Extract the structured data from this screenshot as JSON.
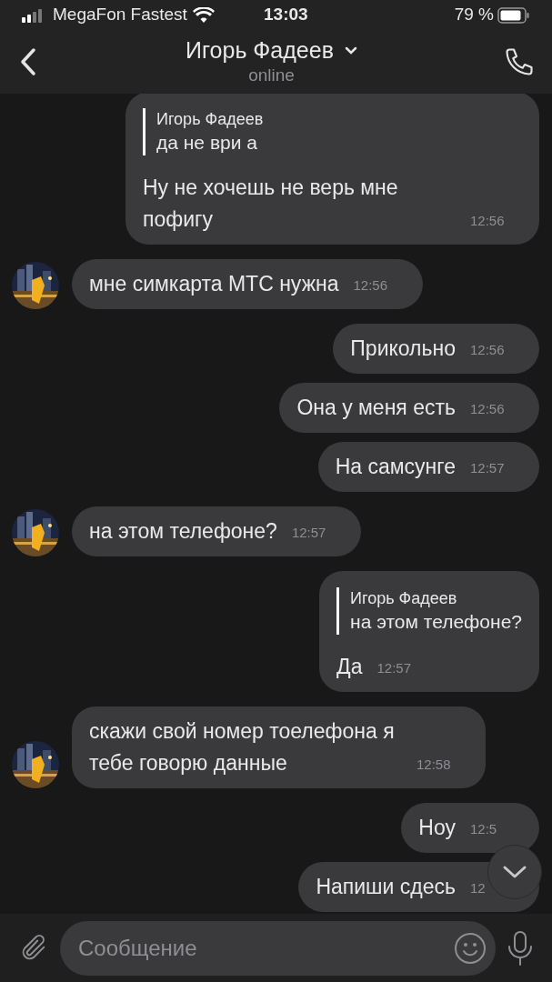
{
  "status_bar": {
    "carrier": "MegaFon Fastest",
    "time": "13:03",
    "battery": "79 %"
  },
  "header": {
    "title": "Игорь Фадеев",
    "subtitle": "online"
  },
  "messages": [
    {
      "kind": "outgoing",
      "quote": {
        "author": "Игорь Фадеев",
        "text": "да не ври а"
      },
      "text": "Ну не хочешь не верь мне пофигу",
      "time": "12:56"
    },
    {
      "kind": "incoming",
      "text": "мне симкарта МТС нужна",
      "time": "12:56"
    },
    {
      "kind": "outgoing",
      "text": "Прикольно",
      "time": "12:56"
    },
    {
      "kind": "outgoing",
      "text": "Она у меня есть",
      "time": "12:56"
    },
    {
      "kind": "outgoing",
      "text": "На самсунге",
      "time": "12:57"
    },
    {
      "kind": "incoming",
      "text": "на этом телефоне?",
      "time": "12:57"
    },
    {
      "kind": "outgoing",
      "quote": {
        "author": "Игорь Фадеев",
        "text": "на этом телефоне?"
      },
      "text": "Да",
      "time": "12:57"
    },
    {
      "kind": "incoming",
      "text": "скажи свой номер тоелефона я тебе говорю данные",
      "time": "12:58"
    },
    {
      "kind": "outgoing",
      "text": "Ноу",
      "time": "12:5"
    },
    {
      "kind": "outgoing",
      "text": "Напиши сдесь",
      "time": "12"
    }
  ],
  "composer": {
    "placeholder": "Сообщение"
  }
}
